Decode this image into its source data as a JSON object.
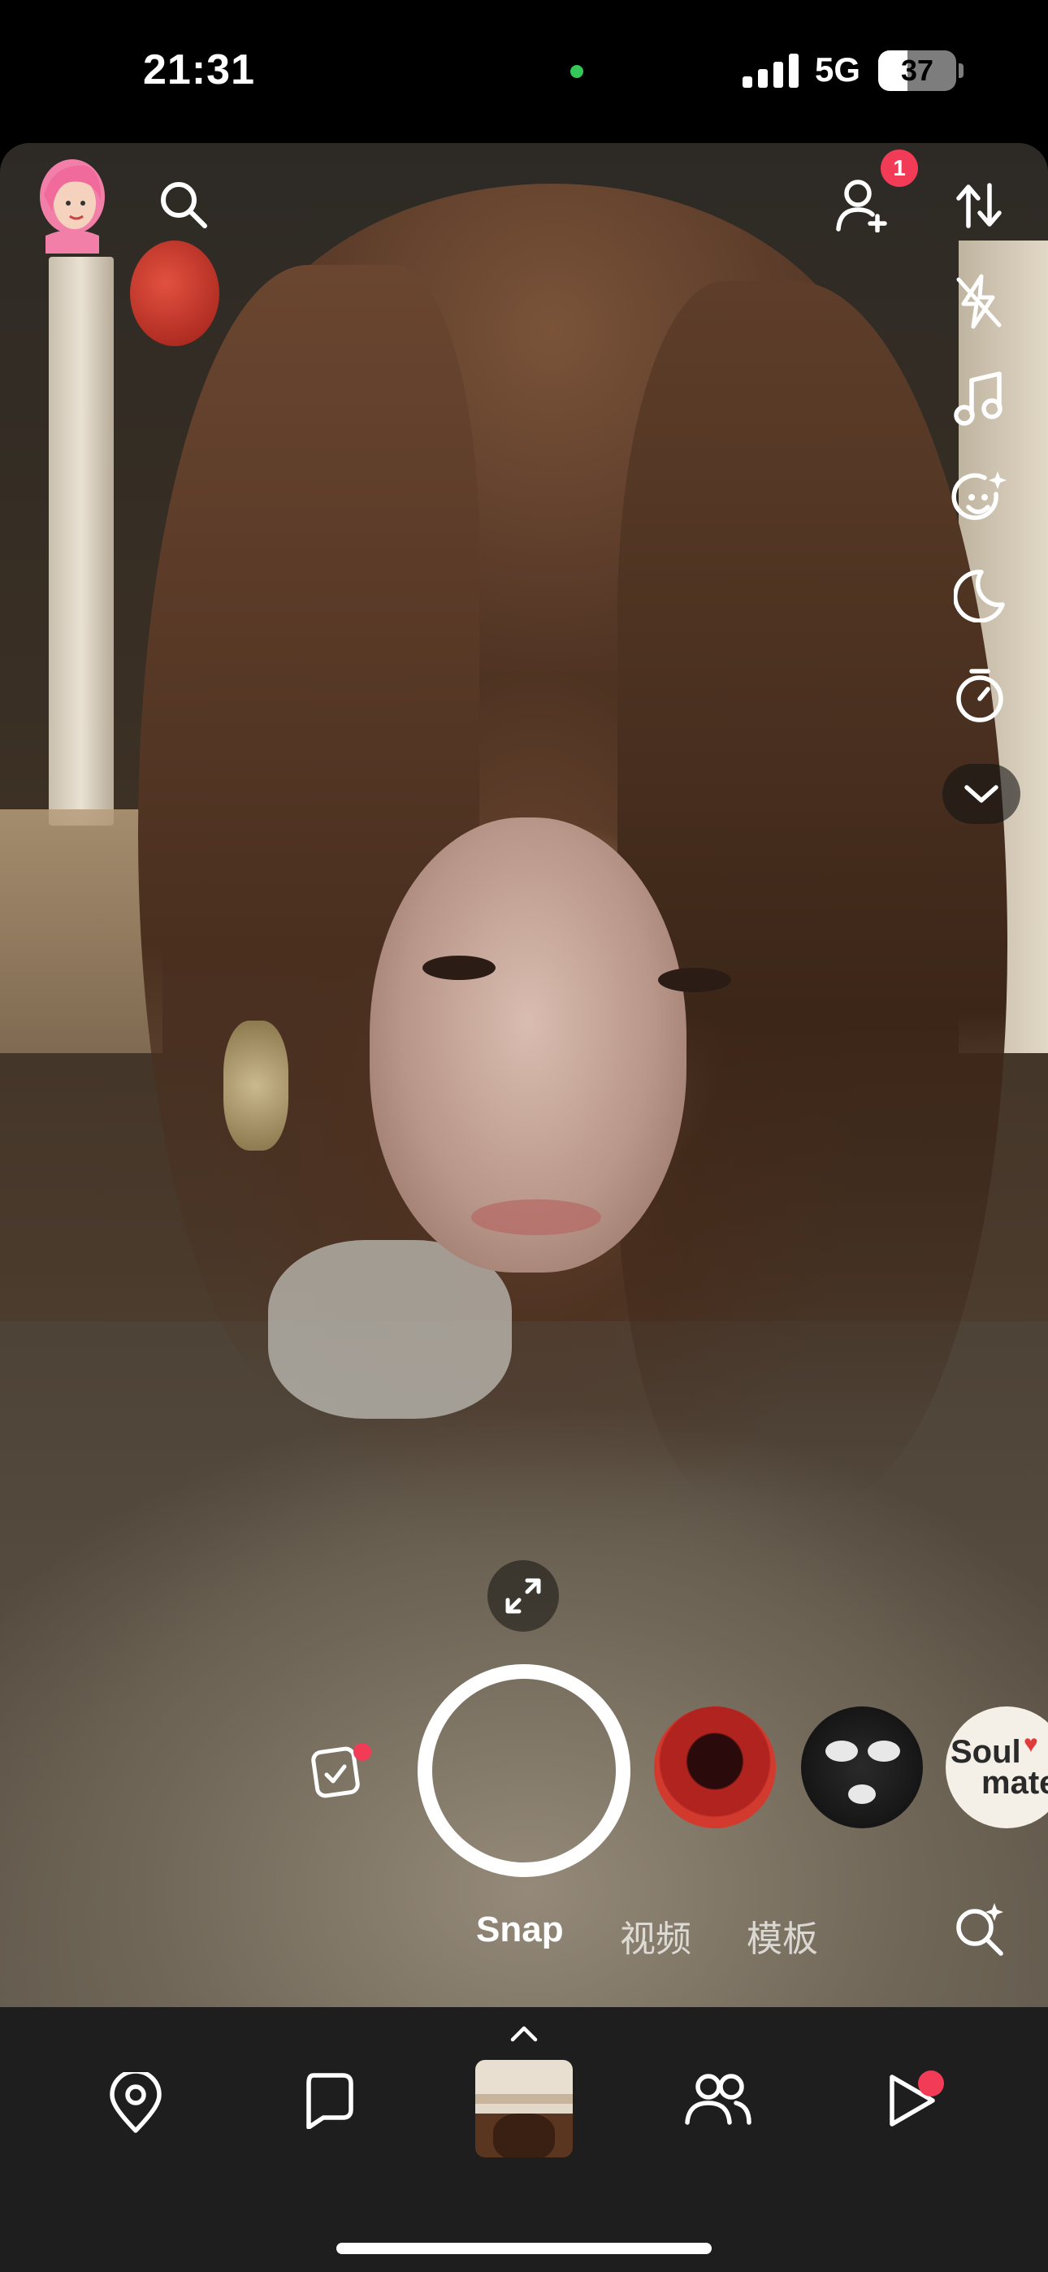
{
  "status_bar": {
    "time": "21:31",
    "network": "5G",
    "battery_level": "37",
    "battery_percent": 37,
    "privacy_indicator_color": "#34c759"
  },
  "camera": {
    "friend_requests_count": "1",
    "top_icons": [
      "avatar-icon",
      "search-icon",
      "add-friend-icon",
      "flip-camera-icon",
      "flash-off-icon",
      "music-icon",
      "lens-sparkle-icon",
      "night-mode-icon",
      "timer-icon",
      "chevron-down-icon"
    ],
    "modes": {
      "snap": "Snap",
      "video": "视频",
      "template": "模板"
    },
    "lenses": [
      "red-portrait-lens",
      "ski-mask-lens",
      "soulmate-lens"
    ],
    "soulmate_lens_label_1": "Soul",
    "soulmate_lens_label_2": "mate"
  },
  "bottom_nav": {
    "items": [
      "map-icon",
      "chat-icon",
      "camera-tab",
      "friends-icon",
      "stories-play-icon"
    ]
  },
  "colors": {
    "badge": "#f23c57",
    "nav_background": "#1e1e1e"
  }
}
